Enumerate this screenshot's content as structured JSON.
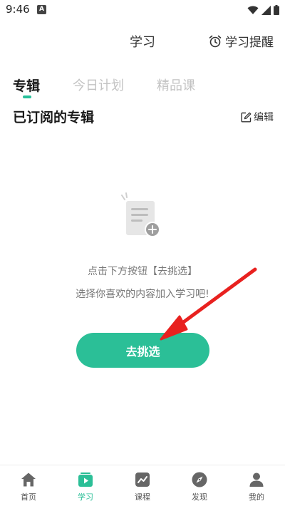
{
  "status_bar": {
    "time": "9:46",
    "app_badge": "A"
  },
  "header": {
    "title": "学习",
    "reminder_label": "学习提醒"
  },
  "tabs": [
    {
      "label": "专辑",
      "active": true
    },
    {
      "label": "今日计划",
      "active": false
    },
    {
      "label": "精品课",
      "active": false
    }
  ],
  "section": {
    "title": "已订阅的专辑",
    "edit_label": "编辑"
  },
  "empty_state": {
    "line1": "点击下方按钮【去挑选】",
    "line2": "选择你喜欢的内容加入学习吧!",
    "button_label": "去挑选"
  },
  "bottom_nav": [
    {
      "label": "首页",
      "icon": "home-icon",
      "active": false
    },
    {
      "label": "学习",
      "icon": "play-icon",
      "active": true
    },
    {
      "label": "课程",
      "icon": "chart-icon",
      "active": false
    },
    {
      "label": "发现",
      "icon": "compass-icon",
      "active": false
    },
    {
      "label": "我的",
      "icon": "user-icon",
      "active": false
    }
  ],
  "colors": {
    "accent": "#2bbf97",
    "annotation_arrow": "#e8211f"
  }
}
